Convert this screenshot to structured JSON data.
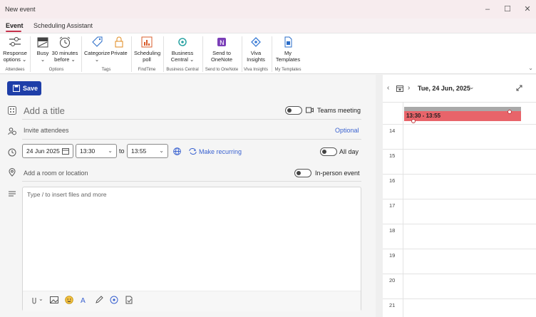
{
  "window": {
    "title": "New event",
    "minimize": "–",
    "maximize": "☐",
    "close": "✕"
  },
  "tabs": [
    {
      "label": "Event",
      "active": true
    },
    {
      "label": "Scheduling Assistant",
      "active": false
    }
  ],
  "ribbon": {
    "response_options": "Response options ⌄",
    "busy": "Busy ⌄",
    "reminder": "30 minutes before ⌄",
    "categorize": "Categorize ⌄",
    "private": "Private",
    "scheduling_poll": "Scheduling poll",
    "business_central": "Business Central ⌄",
    "send_to_onenote": "Send to OneNote",
    "viva_insights": "Viva Insights",
    "my_templates": "My Templates",
    "groups": {
      "attendees": "Attendees",
      "options": "Options",
      "tags": "Tags",
      "findtime": "FindTime",
      "business_central": "Business Central",
      "onenote": "Send to OneNote",
      "viva": "Viva Insights",
      "templates": "My Templates"
    }
  },
  "form": {
    "save_label": "Save",
    "title_placeholder": "Add a title",
    "teams_meeting_label": "Teams meeting",
    "invite_placeholder": "Invite attendees",
    "optional_label": "Optional",
    "date": "24 Jun 2025",
    "start_time": "13:30",
    "to_label": "to",
    "end_time": "13:55",
    "make_recurring": "Make recurring",
    "all_day_label": "All day",
    "location_placeholder": "Add a room or location",
    "in_person_label": "In-person event",
    "body_placeholder": "Type / to insert files and more"
  },
  "calendar": {
    "date_label": "Tue, 24 Jun, 2025",
    "hours": [
      "14",
      "15",
      "16",
      "17",
      "18",
      "19",
      "20",
      "21"
    ],
    "event_label": "13:30 - 13:55",
    "event_color": "#e8646a"
  },
  "colors": {
    "accent": "#1e3ea8",
    "tab_underline": "#c4314b",
    "link": "#3a62d0"
  }
}
